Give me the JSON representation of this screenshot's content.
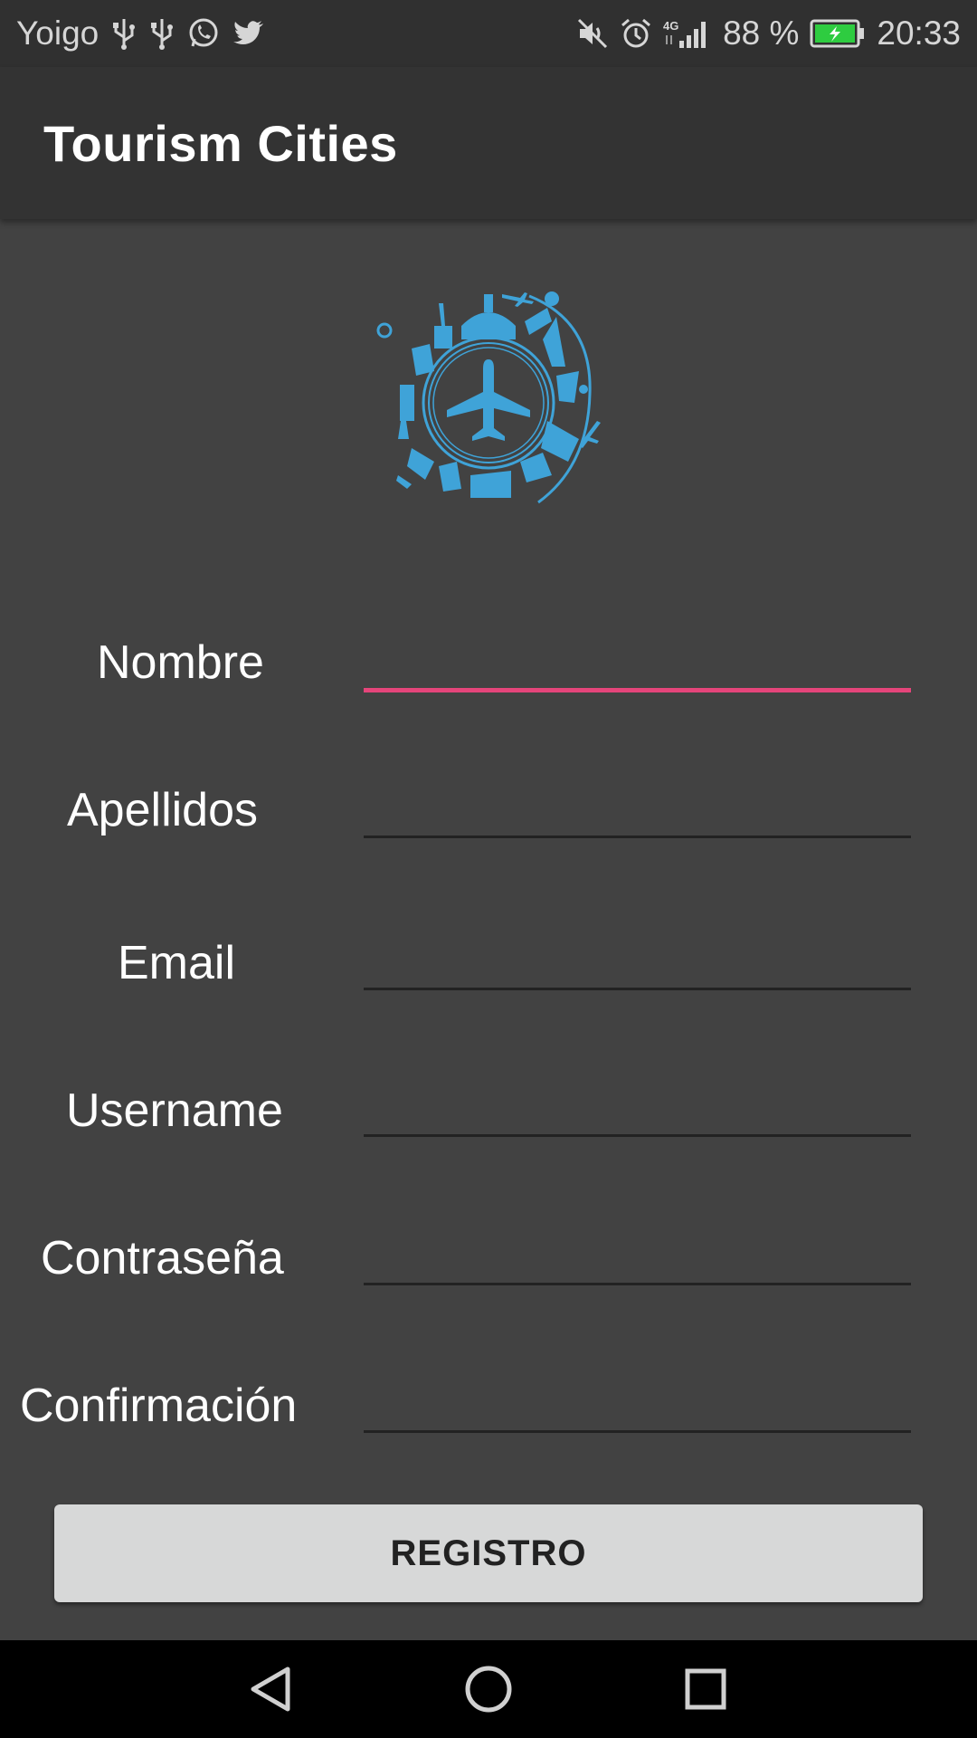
{
  "status_bar": {
    "carrier": "Yoigo",
    "battery": "88 %",
    "time": "20:33",
    "network": "4G",
    "left_icons": [
      "usb-icon",
      "usb-icon",
      "whatsapp-icon",
      "twitter-icon"
    ],
    "right_icons": [
      "mute-icon",
      "alarm-icon",
      "signal-icon",
      "battery-icon"
    ],
    "battery_color": "#2ecc40"
  },
  "app_bar": {
    "title": "Tourism Cities"
  },
  "logo": {
    "icon": "travel-globe-airplane-logo",
    "color": "#3fa3d8"
  },
  "form": {
    "fields": [
      {
        "label": "Nombre",
        "value": "",
        "focused": true
      },
      {
        "label": "Apellidos",
        "value": ""
      },
      {
        "label": "Email",
        "value": ""
      },
      {
        "label": "Username",
        "value": ""
      },
      {
        "label": "Contraseña",
        "value": ""
      },
      {
        "label": "Confirmación",
        "value": ""
      }
    ],
    "submit_label": "REGISTRO",
    "accent_color": "#e5457a"
  },
  "nav_bar": {
    "buttons": [
      "back-icon",
      "home-icon",
      "recents-icon"
    ]
  }
}
